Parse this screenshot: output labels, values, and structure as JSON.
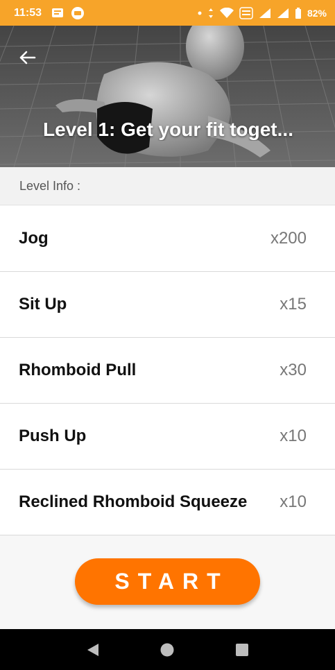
{
  "status_bar": {
    "time": "11:53",
    "battery": "82%",
    "network_badge": "VoLTE",
    "icons": [
      "message-icon",
      "chat-bubble-icon",
      "dot-icon",
      "data-arrows-icon",
      "wifi-icon",
      "volte-icon",
      "signal-icon",
      "signal-icon",
      "battery-icon"
    ]
  },
  "header": {
    "title": "Level 1: Get your fit toget...",
    "back_icon": "arrow-left-icon"
  },
  "section": {
    "label": "Level Info :"
  },
  "exercises": [
    {
      "name": "Jog",
      "count": "x200"
    },
    {
      "name": "Sit Up",
      "count": "x15"
    },
    {
      "name": "Rhomboid Pull",
      "count": "x30"
    },
    {
      "name": "Push Up",
      "count": "x10"
    },
    {
      "name": "Reclined Rhomboid Squeeze",
      "count": "x10"
    }
  ],
  "actions": {
    "start_label": "START"
  },
  "colors": {
    "status_bar": "#f7a429",
    "start_button": "#ff7400",
    "section_header_bg": "#f2f2f2",
    "nav_bar": "#000000"
  },
  "nav": [
    "back-triangle-icon",
    "home-circle-icon",
    "recents-square-icon"
  ]
}
